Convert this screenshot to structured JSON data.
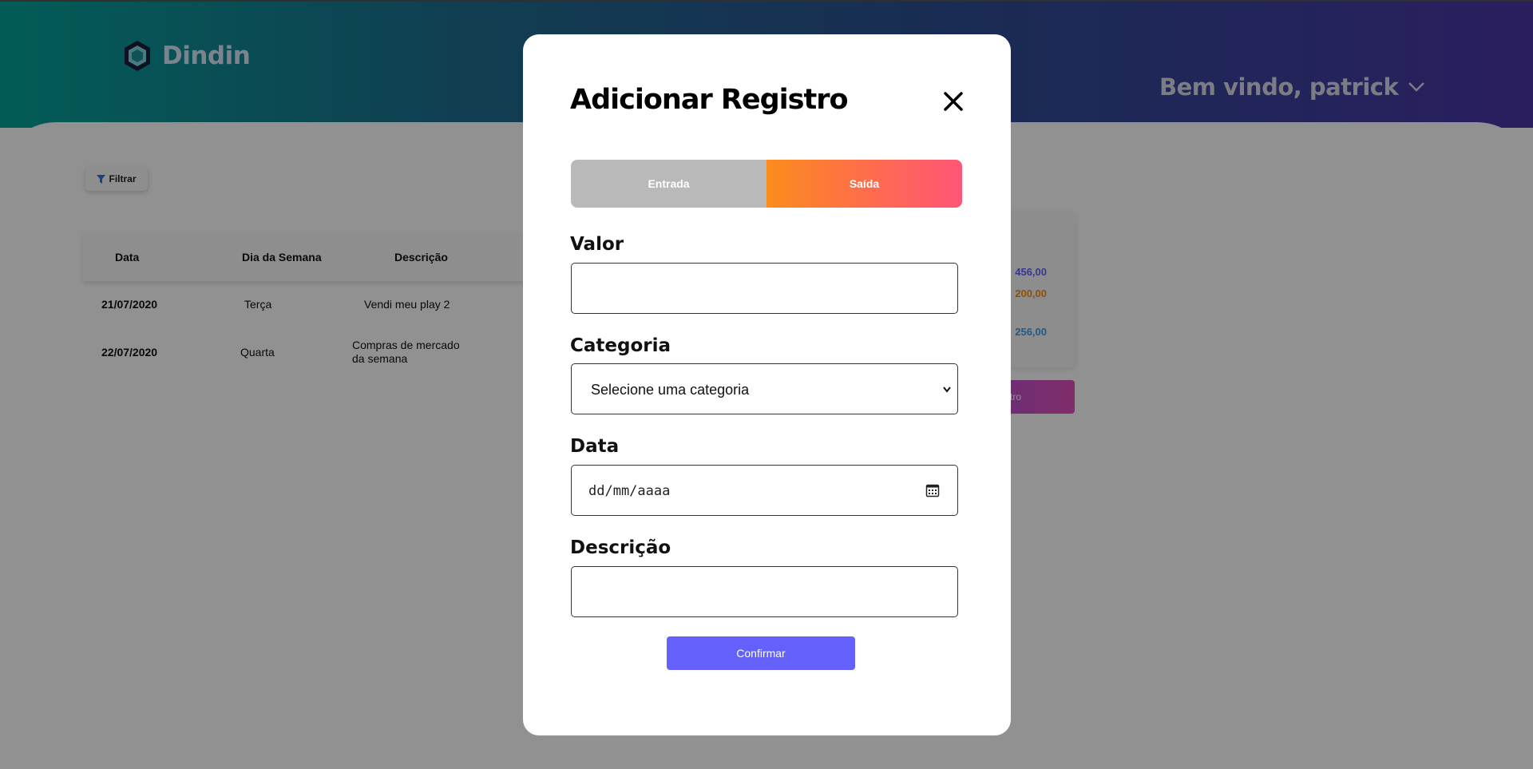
{
  "app": {
    "name": "Dindin",
    "welcome": "Bem vindo, patrick"
  },
  "toolbar": {
    "filter_label": "Filtrar"
  },
  "table": {
    "headers": [
      "Data",
      "Dia da Semana",
      "Descrição"
    ],
    "rows": [
      {
        "date": "21/07/2020",
        "weekday": "Terça",
        "description": "Vendi meu play 2"
      },
      {
        "date": "22/07/2020",
        "weekday": "Quarta",
        "description_lines": [
          "Compras de mercado",
          "da semana"
        ]
      }
    ]
  },
  "summary": {
    "entrada_partial": "456,00",
    "saida_partial": "200,00",
    "saldo_partial": "256,00",
    "add_button_partial": "tro"
  },
  "modal": {
    "title": "Adicionar Registro",
    "toggle": {
      "entrada_label": "Entrada",
      "saida_label": "Saída",
      "selected": "Saída"
    },
    "fields": {
      "valor_label": "Valor",
      "valor_value": "",
      "categoria_label": "Categoria",
      "categoria_selected": "Selecione uma categoria",
      "data_label": "Data",
      "data_placeholder": "dd/mm/aaaa",
      "descricao_label": "Descrição",
      "descricao_value": ""
    },
    "confirm_label": "Confirmar"
  },
  "colors": {
    "accent": "#6460fb",
    "entrada": "#6460fb",
    "saida": "#fa8c10",
    "saldo": "#3a9ff1",
    "toggle_inactive": "#b9b9b9"
  },
  "icons": [
    "logo-hexagon-icon",
    "chevron-down-icon",
    "filter-icon",
    "close-icon",
    "calendar-icon"
  ]
}
